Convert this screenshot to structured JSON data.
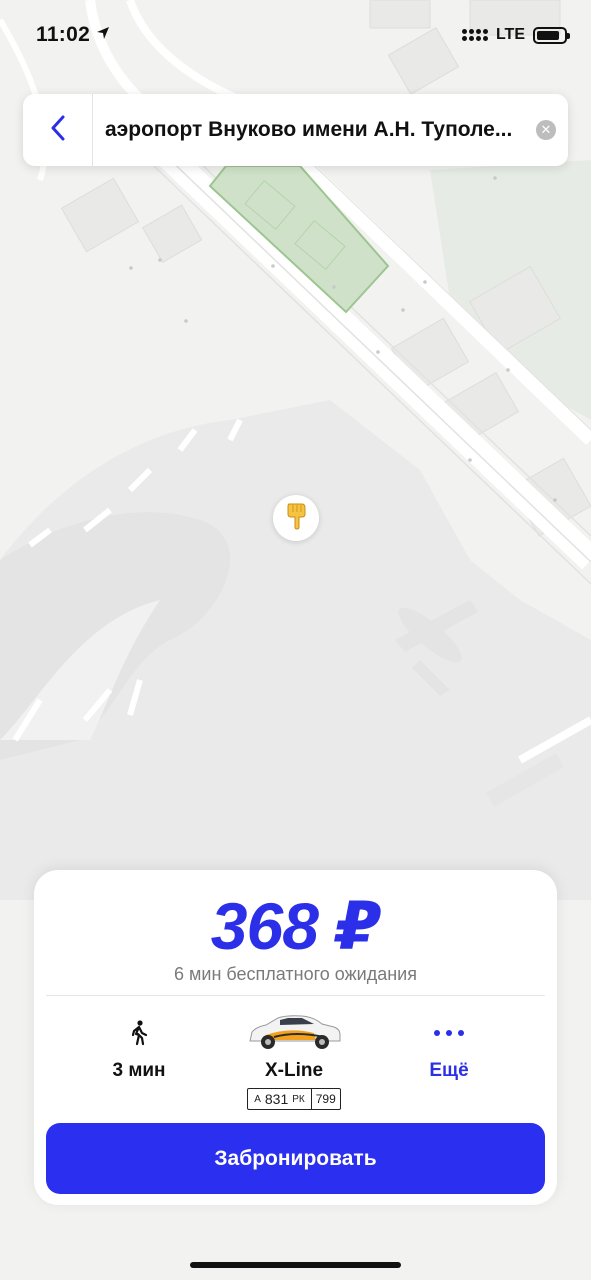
{
  "status_bar": {
    "time": "11:02",
    "network": "LTE"
  },
  "search": {
    "destination": "аэропорт Внуково имени А.Н. Туполе..."
  },
  "map": {
    "pin_icon": "pointing-hand-icon"
  },
  "order": {
    "price": "368 ₽",
    "waiting_note": "6 мин бесплатного ожидания",
    "walk_time": "3 мин",
    "tariff_name": "X-Line",
    "plate_letter1": "А",
    "plate_number": "831",
    "plate_letters2": "РК",
    "plate_region": "799",
    "more_label": "Ещё",
    "book_label": "Забронировать"
  },
  "colors": {
    "accent": "#2b2fe8",
    "button": "#2b2ff0"
  }
}
